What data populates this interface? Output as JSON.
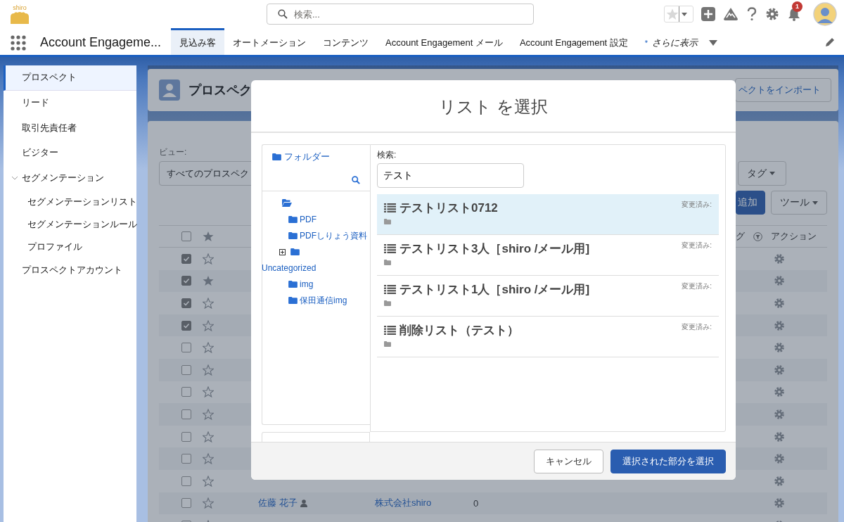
{
  "header": {
    "logo_text": "shiro",
    "search": {
      "placeholder": "検索..."
    },
    "notifications": {
      "badge": "1"
    }
  },
  "nav": {
    "app_name": "Account Engageme...",
    "tabs": [
      {
        "label": "見込み客",
        "selected": true
      },
      {
        "label": "オートメーション",
        "selected": false
      },
      {
        "label": "コンテンツ",
        "selected": false
      },
      {
        "label": "Account Engagement メール",
        "selected": false
      },
      {
        "label": "Account Engagement 設定",
        "selected": false
      },
      {
        "label": "さらに表示",
        "marker": "*",
        "kind": "more",
        "selected": false
      }
    ]
  },
  "sidebar": {
    "items": [
      {
        "label": "プロスペクト",
        "selected": true
      },
      {
        "label": "リード",
        "selected": false
      },
      {
        "label": "取引先責任者",
        "selected": false
      },
      {
        "label": "ビジター",
        "selected": false
      },
      {
        "label": "セグメンテーション",
        "selected": false,
        "expanded": true,
        "children": [
          {
            "label": "セグメンテーションリスト",
            "selected": false
          },
          {
            "label": "セグメンテーションルール",
            "selected": false
          },
          {
            "label": "プロファイル",
            "selected": false
          }
        ]
      },
      {
        "label": "プロスペクトアカウント",
        "selected": false
      }
    ]
  },
  "page": {
    "title": "プロスペク",
    "import_button": "ペクトをインポート",
    "view_label": "ビュー:",
    "view_select": "すべてのプロスペク",
    "tag_button": "タグ",
    "add_button": "追加",
    "tools_button": "ツール",
    "table": {
      "columns": [
        {
          "kind": "select",
          "checked": false
        },
        {
          "kind": "star"
        },
        {
          "kind": "tags",
          "label": "グ"
        },
        {
          "kind": "action",
          "label": "アクション"
        }
      ],
      "rows": [
        {
          "checked": true,
          "starred": false
        },
        {
          "checked": true,
          "starred": true
        },
        {
          "checked": true,
          "starred": false
        },
        {
          "checked": true,
          "starred": false
        },
        {
          "checked": false,
          "starred": false
        },
        {
          "checked": false,
          "starred": false
        },
        {
          "checked": false,
          "starred": false
        },
        {
          "checked": false,
          "starred": false
        },
        {
          "checked": false,
          "starred": false
        },
        {
          "checked": false,
          "starred": false
        },
        {
          "checked": false,
          "starred": false
        },
        {
          "checked": false,
          "starred": false,
          "column_3": "佐藤 花子",
          "column_4": "株式会社shiro",
          "column_5": "0"
        },
        {
          "checked": false,
          "starred": false
        }
      ]
    }
  },
  "modal": {
    "title": "リスト を選択",
    "folders": {
      "root_link": "フォルダー",
      "tree": [
        {
          "expanded": true,
          "children": [
            {
              "label": "PDF"
            },
            {
              "label": "PDFしりょう資料"
            },
            {
              "label": "Uncategorized",
              "expanded": false
            },
            {
              "label": "img"
            },
            {
              "label": "保田通信img"
            }
          ]
        }
      ]
    },
    "search": {
      "label": "検索:",
      "value": "テスト"
    },
    "lists": [
      {
        "name": "テストリスト0712",
        "meta": "変更済み:",
        "selected": true
      },
      {
        "name": "テストリスト3人［shiro /メール用]",
        "meta": "変更済み:",
        "selected": false
      },
      {
        "name": "テストリスト1人［shiro /メール用]",
        "meta": "変更済み:",
        "selected": false
      },
      {
        "name": "削除リスト（テスト）",
        "meta": "変更済み:",
        "selected": false
      }
    ],
    "buttons": [
      {
        "label": "キャンセル",
        "kind": "secondary"
      },
      {
        "label": "選択された部分を選択",
        "kind": "primary"
      }
    ]
  }
}
